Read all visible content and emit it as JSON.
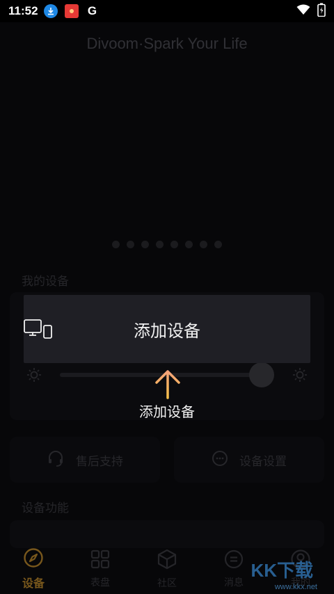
{
  "status": {
    "time": "11:52",
    "icons": [
      "download-icon",
      "app-icon",
      "google-icon",
      "wifi-icon",
      "battery-icon"
    ]
  },
  "app": {
    "slogan": "Divoom·Spark Your Life",
    "carousel_dots": 8,
    "my_devices_title": "我的设备",
    "device_functions_title": "设备功能",
    "support_button": "售后支持",
    "settings_button": "设备设置"
  },
  "guide": {
    "add_device_label": "添加设备",
    "hint_label": "添加设备"
  },
  "tabs": [
    {
      "label": "设备",
      "icon": "compass-icon",
      "active": true
    },
    {
      "label": "表盘",
      "icon": "grid-icon",
      "active": false
    },
    {
      "label": "社区",
      "icon": "cube-icon",
      "active": false
    },
    {
      "label": "消息",
      "icon": "message-icon",
      "active": false
    },
    {
      "label": "我的",
      "icon": "user-icon",
      "active": false
    }
  ],
  "watermark": {
    "brand": "KK下载",
    "url": "www.kkx.net"
  },
  "colors": {
    "accent": "#b8862b",
    "arrow_top": "#f4a27a",
    "arrow_bottom": "#f7c04a"
  }
}
